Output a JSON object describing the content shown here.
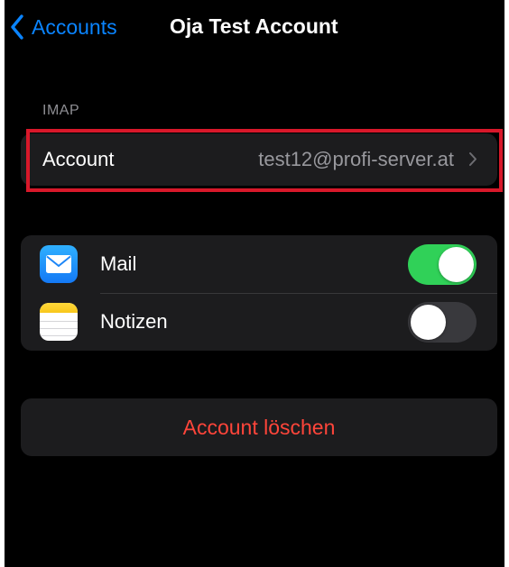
{
  "nav": {
    "back_label": "Accounts",
    "title": "Oja Test Account"
  },
  "imap_section": {
    "label": "IMAP",
    "account_row": {
      "label": "Account",
      "value": "test12@profi-server.at",
      "icon": "chevron-right-icon"
    }
  },
  "apps": [
    {
      "label": "Mail",
      "icon": "mail-icon",
      "enabled": true
    },
    {
      "label": "Notizen",
      "icon": "notes-icon",
      "enabled": false
    }
  ],
  "delete": {
    "label": "Account löschen"
  },
  "colors": {
    "accent": "#0a84ff",
    "toggle_on": "#30d158",
    "destructive": "#ff453a",
    "highlight": "#d8182a"
  }
}
